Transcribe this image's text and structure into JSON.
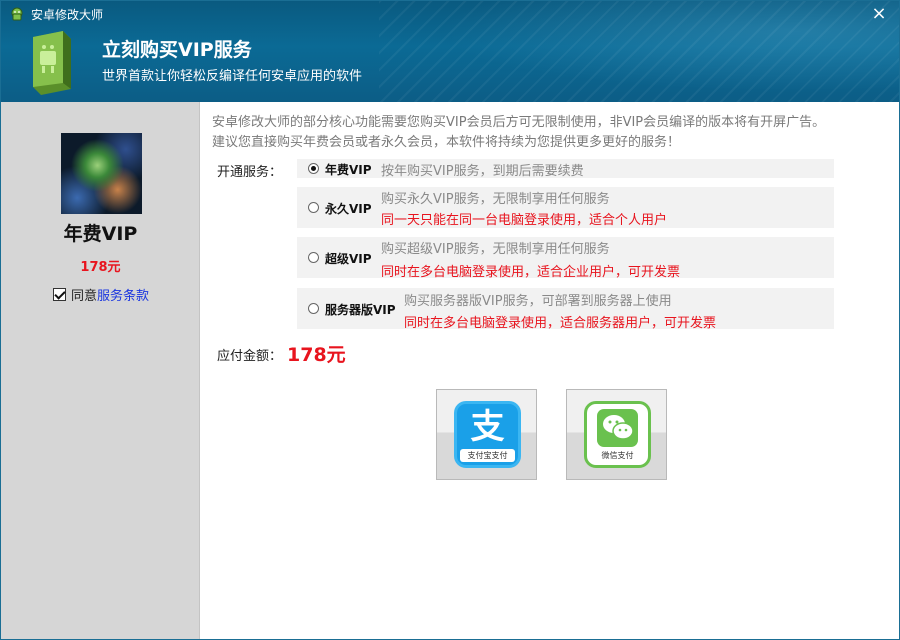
{
  "window": {
    "title": "安卓修改大师",
    "close_glyph": "×"
  },
  "header": {
    "title": "立刻购买VIP服务",
    "subtitle": "世界首款让你轻松反编译任何安卓应用的软件"
  },
  "left_panel": {
    "vip_name": "年费VIP",
    "vip_price": "178元",
    "agree_checked": true,
    "agree_text": "同意",
    "terms_link": "服务条款"
  },
  "main": {
    "notice_line1": "安卓修改大师的部分核心功能需要您购买VIP会员后方可无限制使用，非VIP会员编译的版本将有开屏广告。",
    "notice_line2": "建议您直接购买年费会员或者永久会员，本软件将持续为您提供更多更好的服务！",
    "service_label": "开通服务：",
    "options": [
      {
        "name": "年费VIP",
        "desc": "按年购买VIP服务，到期后需要续费",
        "note": "",
        "selected": true
      },
      {
        "name": "永久VIP",
        "desc": "购买永久VIP服务，无限制享用任何服务",
        "note": "同一天只能在同一台电脑登录使用，适合个人用户",
        "selected": false
      },
      {
        "name": "超级VIP",
        "desc": "购买超级VIP服务，无限制享用任何服务",
        "note": "同时在多台电脑登录使用，适合企业用户，可开发票",
        "selected": false
      },
      {
        "name": "服务器版VIP",
        "desc": "购买服务器版VIP服务，可部署到服务器上使用",
        "note": "同时在多台电脑登录使用，适合服务器用户，可开发票",
        "selected": false
      }
    ],
    "amount_label": "应付金额：",
    "amount_value": "178元"
  },
  "payment": {
    "alipay_glyph": "支",
    "alipay_label": "支付宝支付",
    "wechat_label": "微信支付"
  },
  "colors": {
    "header_bg": "#0b6a95",
    "price_red": "#e8141e",
    "link_blue": "#1a35e0",
    "left_panel_bg": "#d6d6d6",
    "alipay_blue": "#1aa0e8",
    "wechat_green": "#6ac14e"
  },
  "icons": {
    "titlebar": "android-robot-icon",
    "app_logo": "android-box-icon",
    "close": "close-icon",
    "vip_image": "galaxy-image",
    "alipay": "alipay-icon",
    "wechat": "wechat-pay-icon"
  }
}
